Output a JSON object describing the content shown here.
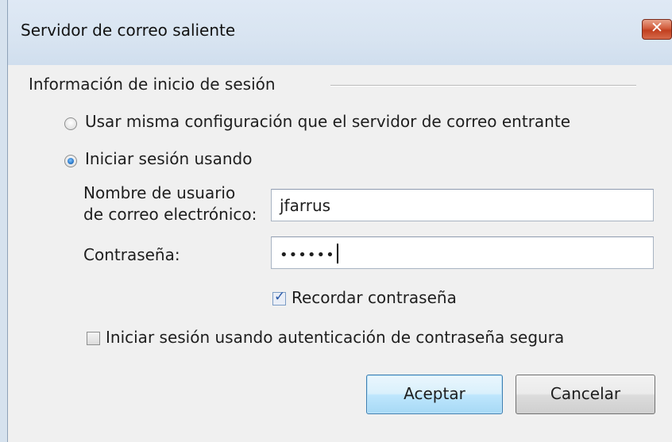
{
  "window": {
    "title": "Servidor de correo saliente",
    "close_symbol": "✕"
  },
  "group": {
    "label": "Información de inicio de sesión"
  },
  "options": {
    "same_config_label": "Usar misma configuración que el servidor de correo entrante",
    "same_config_selected": false,
    "login_using_label": "Iniciar sesión usando",
    "login_using_selected": true
  },
  "fields": {
    "username_label_line1": "Nombre de usuario",
    "username_label_line2": "de correo electrónico:",
    "username_value": "jfarrus",
    "password_label": "Contraseña:",
    "password_value": "••••••"
  },
  "remember": {
    "label": "Recordar contraseña",
    "checked": true
  },
  "secure_auth": {
    "label": "Iniciar sesión usando autenticación de contraseña segura",
    "checked": false
  },
  "buttons": {
    "accept": "Aceptar",
    "cancel": "Cancelar"
  },
  "colors": {
    "titlebar": "#dfe9f5",
    "client": "#f0f0f0",
    "default_button": "#bee6fd",
    "close_button": "#c13f1f"
  },
  "icons": [
    "close-icon",
    "radio-icon",
    "checkbox-icon",
    "check-icon"
  ]
}
